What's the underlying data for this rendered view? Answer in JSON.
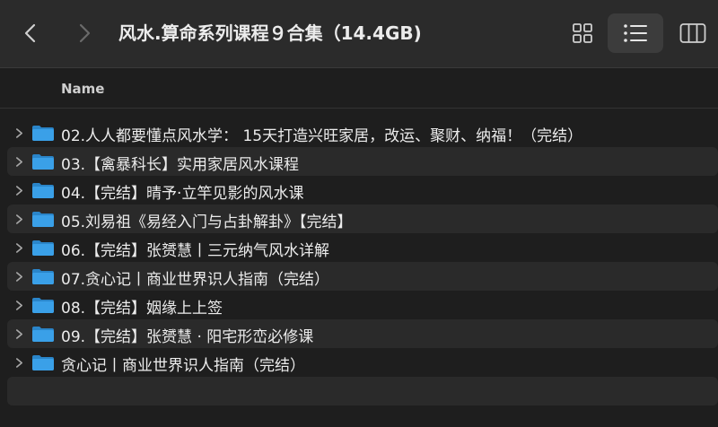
{
  "window": {
    "title": "风水.算命系列课程９合集（14.4GB)"
  },
  "toolbar": {
    "back_icon": "chevron-left-icon",
    "forward_icon": "chevron-right-icon",
    "views": [
      "grid-view-icon",
      "list-view-icon",
      "column-view-icon"
    ],
    "active_view": "list"
  },
  "columns": {
    "name": "Name"
  },
  "items": [
    {
      "name": "02.人人都要懂点风水学： 15天打造兴旺家居，改运、聚财、纳福！（完结）",
      "kind": "folder"
    },
    {
      "name": "03.【禽暴科长】实用家居风水课程",
      "kind": "folder"
    },
    {
      "name": "04.【完结】晴予·立竿见影的风水课",
      "kind": "folder"
    },
    {
      "name": "05.刘易祖《易经入门与占卦解卦》【完结】",
      "kind": "folder"
    },
    {
      "name": "06.【完结】张赟慧丨三元纳气风水详解",
      "kind": "folder"
    },
    {
      "name": "07.贪心记丨商业世界识人指南（完结）",
      "kind": "folder"
    },
    {
      "name": "08.【完结】姻缘上上签",
      "kind": "folder"
    },
    {
      "name": "09.【完结】张赟慧 · 阳宅形峦必修课",
      "kind": "folder"
    },
    {
      "name": "贪心记丨商业世界识人指南（完结）",
      "kind": "folder"
    }
  ],
  "colors": {
    "folder": "#3aa0e8",
    "folder_dark": "#2a85c9",
    "row_alt": "#2a2a2a",
    "background": "#1e1e1e",
    "toolbar": "#2b2b2b"
  }
}
